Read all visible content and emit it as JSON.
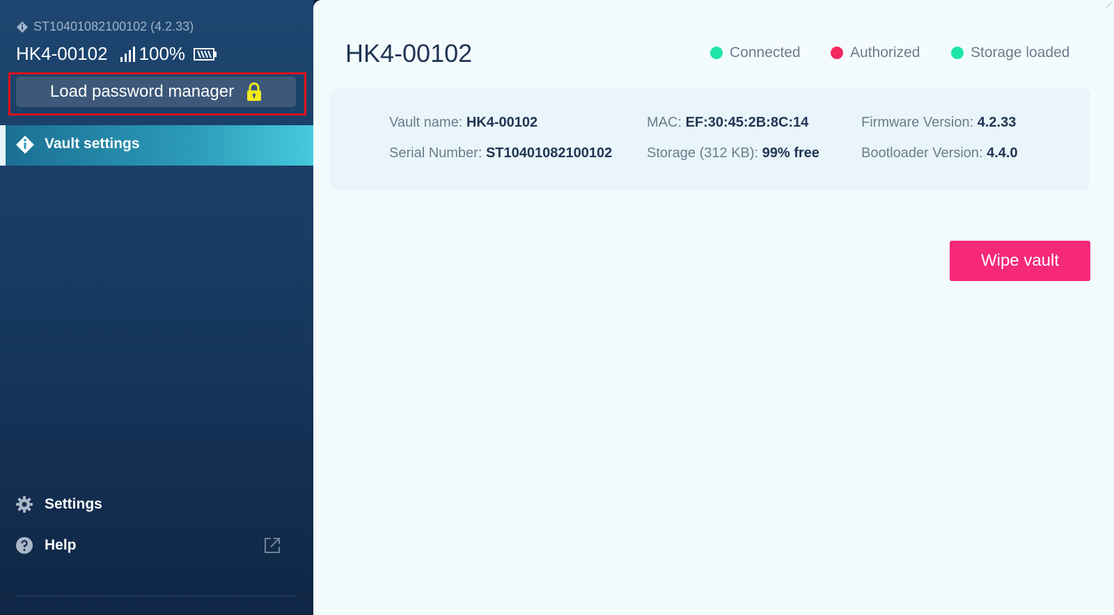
{
  "sidebar": {
    "device_id": "ST10401082100102 (4.2.33)",
    "device_name": "HK4-00102",
    "battery_percent": "100%",
    "load_button_label": "Load password manager",
    "nav_active_label": "Vault settings",
    "settings_label": "Settings",
    "help_label": "Help"
  },
  "main": {
    "title": "HK4-00102",
    "statuses": [
      {
        "label": "Connected",
        "color": "#1ee6a8"
      },
      {
        "label": "Authorized",
        "color": "#f5285f"
      },
      {
        "label": "Storage loaded",
        "color": "#1ee6a8"
      }
    ],
    "info": {
      "vault_name_label": "Vault name:",
      "vault_name_value": "HK4-00102",
      "serial_label": "Serial Number:",
      "serial_value": "ST10401082100102",
      "mac_label": "MAC:",
      "mac_value": "EF:30:45:2B:8C:14",
      "storage_label": "Storage (312 KB):",
      "storage_value": "99% free",
      "firmware_label": "Firmware Version:",
      "firmware_value": "4.2.33",
      "bootloader_label": "Bootloader Version:",
      "bootloader_value": "4.4.0"
    },
    "wipe_button_label": "Wipe vault"
  },
  "colors": {
    "accent": "#46c9dc",
    "danger": "#f5287a",
    "highlight": "#e4101a"
  },
  "icons": [
    "diamond-info-icon",
    "signal-icon",
    "battery-icon",
    "lock-icon",
    "gear-icon",
    "help-icon",
    "external-link-icon"
  ]
}
